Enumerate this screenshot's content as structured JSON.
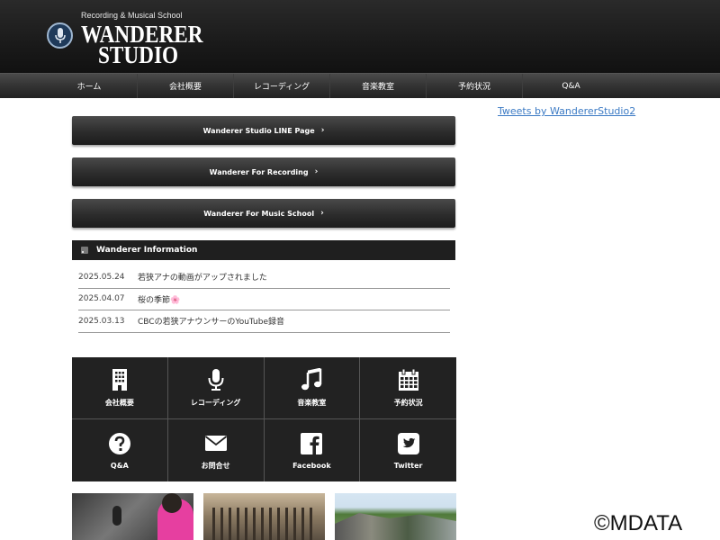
{
  "header": {
    "tagline": "Recording & Musical School",
    "brand_line1": "WANDERER",
    "brand_line2": "STUDIO"
  },
  "nav": {
    "items": [
      {
        "label": "ホーム"
      },
      {
        "label": "会社概要"
      },
      {
        "label": "レコーディング"
      },
      {
        "label": "音楽教室"
      },
      {
        "label": "予約状況"
      },
      {
        "label": "Q&A"
      }
    ]
  },
  "sidebar": {
    "tweets_link": "Tweets by WandererStudio2"
  },
  "buttons": [
    {
      "label": "Wanderer Studio LINE Page",
      "chevron": "›"
    },
    {
      "label": "Wanderer For Recording",
      "chevron": "›"
    },
    {
      "label": "Wanderer For Music School",
      "chevron": "›"
    }
  ],
  "info": {
    "title": "Wanderer Information",
    "icon": "rss-icon",
    "items": [
      {
        "date": "2025.05.24",
        "title": "若狭アナの動画がアップされました"
      },
      {
        "date": "2025.04.07",
        "title": "桜の季節",
        "emoji": "🌸"
      },
      {
        "date": "2025.03.13",
        "title": "CBCの若狭アナウンサーのYouTube録音"
      }
    ]
  },
  "grid": {
    "items": [
      {
        "label": "会社概要",
        "icon": "building-icon"
      },
      {
        "label": "レコーディング",
        "icon": "microphone-icon"
      },
      {
        "label": "音楽教室",
        "icon": "music-note-icon"
      },
      {
        "label": "予約状況",
        "icon": "calendar-icon"
      },
      {
        "label": "Q&A",
        "icon": "question-icon"
      },
      {
        "label": "お問合せ",
        "icon": "envelope-icon"
      },
      {
        "label": "Facebook",
        "icon": "facebook-icon"
      },
      {
        "label": "Twitter",
        "icon": "twitter-icon"
      }
    ]
  },
  "watermark": "©MDATA",
  "colors": {
    "header_bg": "#1a1a1a",
    "nav_bg": "#333333",
    "link": "#3b7ac4",
    "grid_bg": "#222222"
  }
}
